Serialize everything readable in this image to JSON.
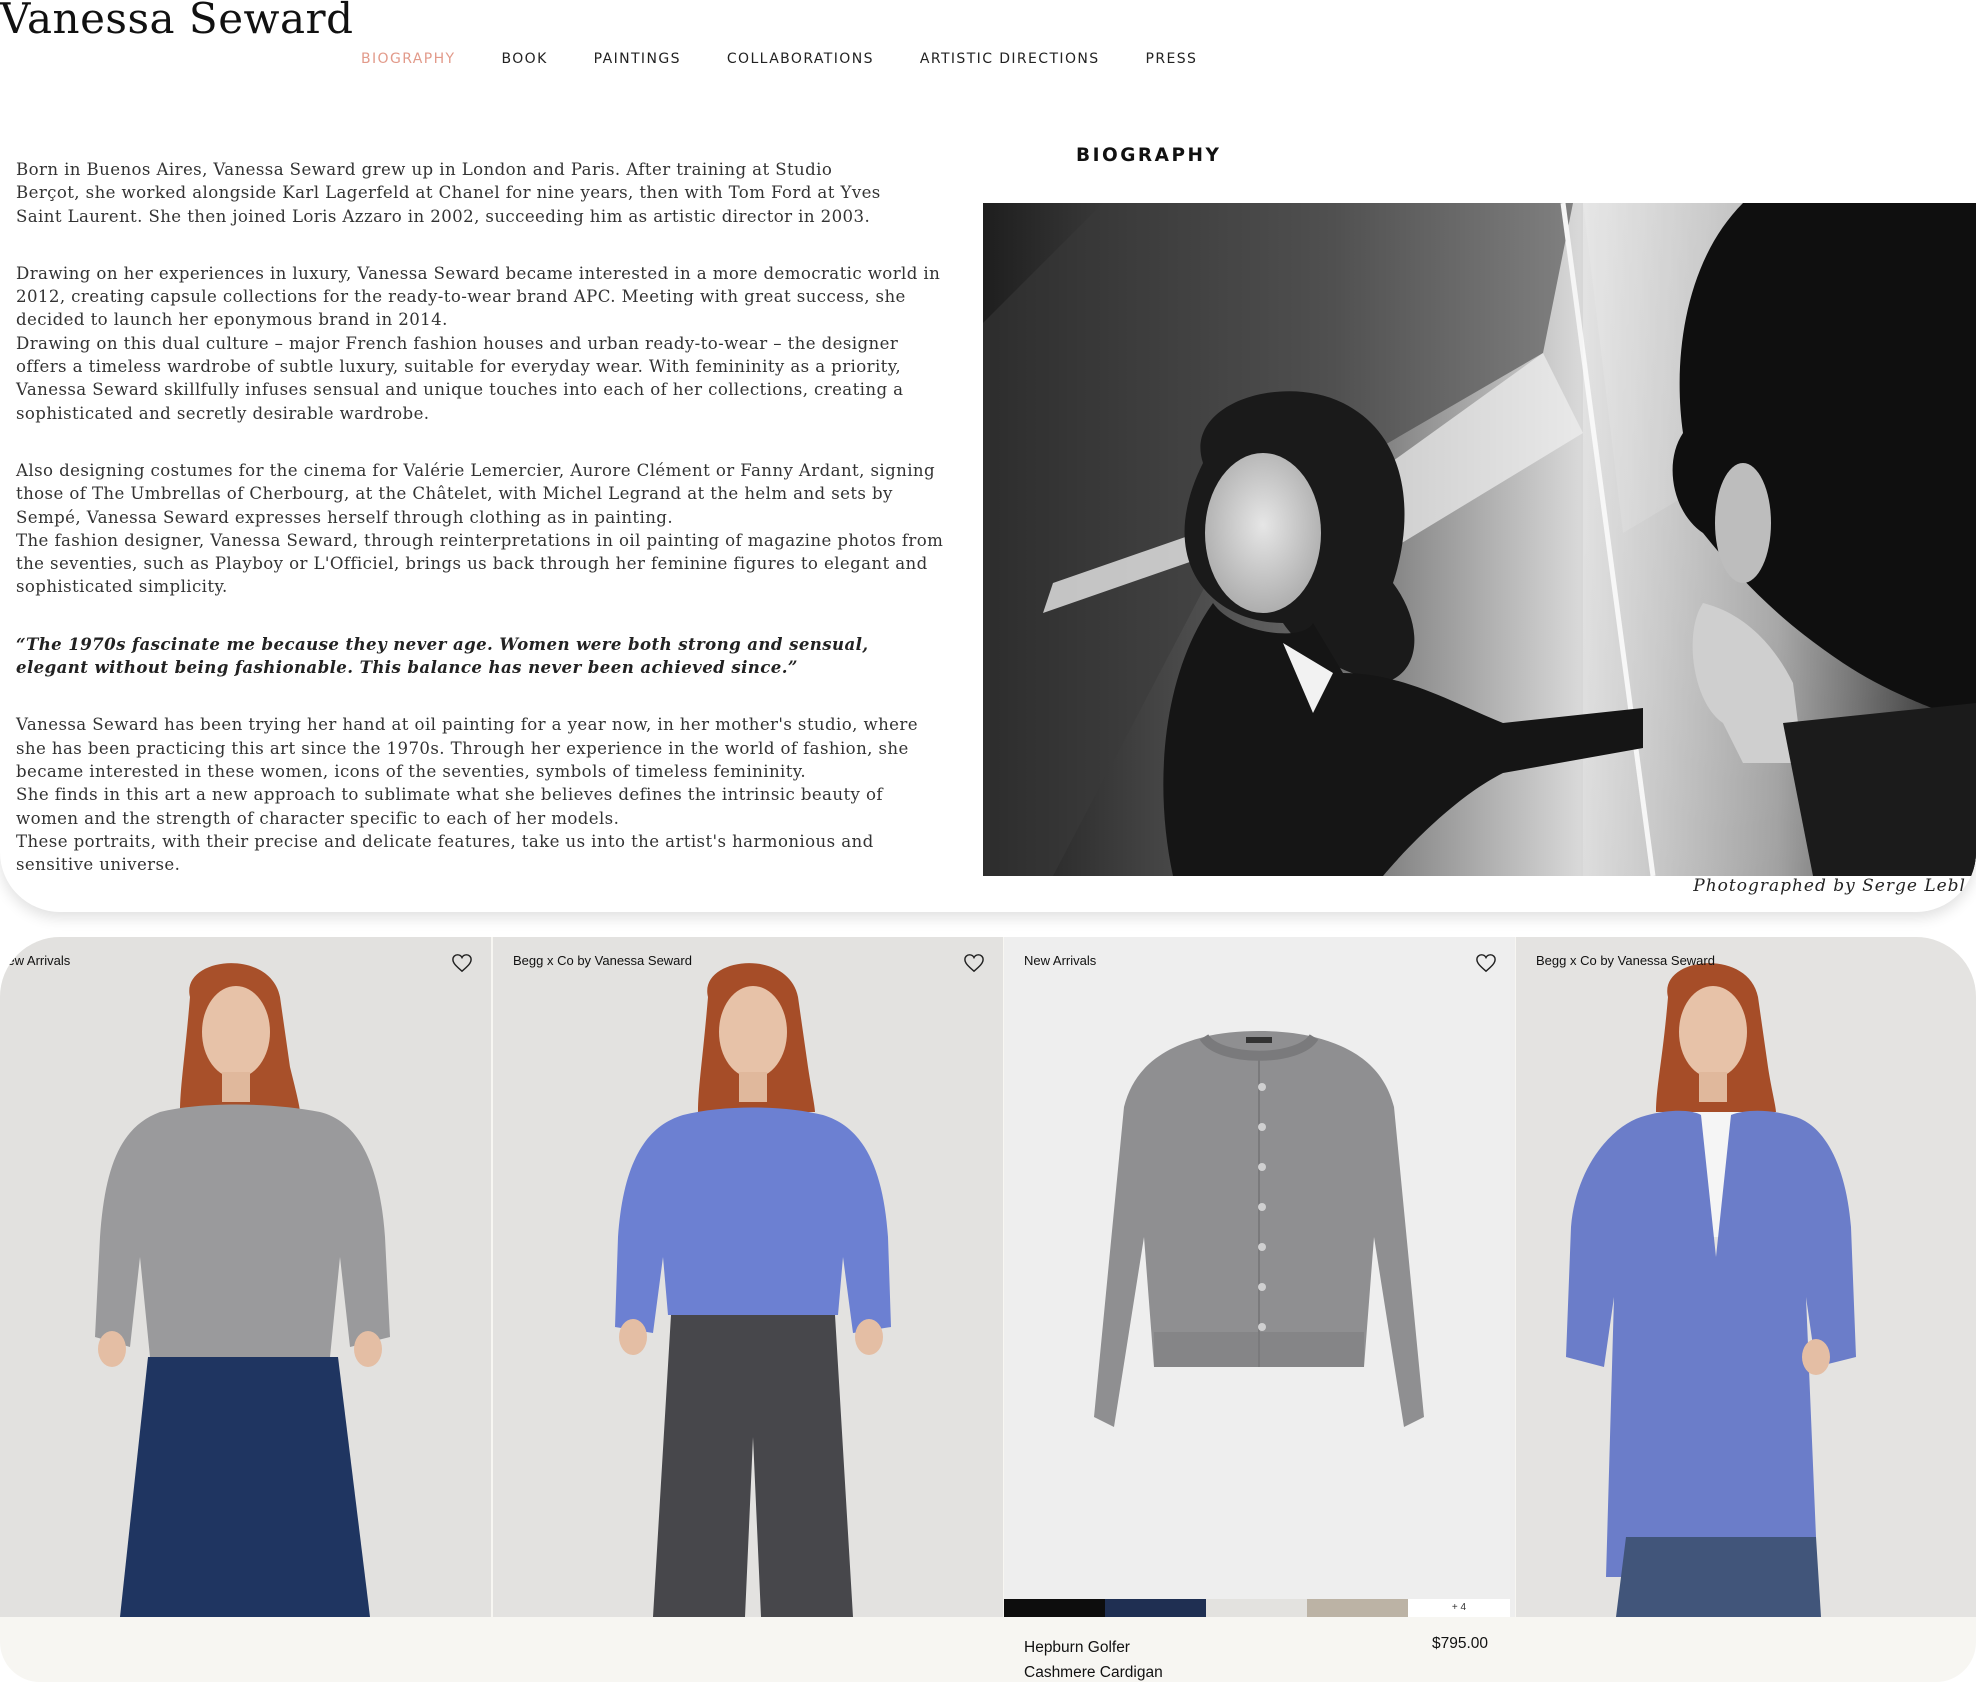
{
  "site": {
    "logo": "Vanessa Seward"
  },
  "nav": {
    "items": [
      {
        "label": "BIOGRAPHY",
        "active": true
      },
      {
        "label": "BOOK"
      },
      {
        "label": "PAINTINGS"
      },
      {
        "label": "COLLABORATIONS"
      },
      {
        "label": "ARTISTIC DIRECTIONS"
      },
      {
        "label": "PRESS"
      }
    ],
    "active_color": "#e29a8a"
  },
  "biography": {
    "heading": "BIOGRAPHY",
    "paragraphs": [
      [
        "Born in Buenos Aires, Vanessa Seward grew up in London and Paris. After training at Studio",
        "Berçot, she worked alongside Karl Lagerfeld at Chanel for nine years, then with Tom Ford at Yves",
        "Saint Laurent. She then joined Loris Azzaro in 2002, succeeding him as artistic director in 2003."
      ],
      [
        "Drawing on her experiences in luxury, Vanessa Seward became interested in a more democratic world in",
        "2012, creating capsule collections for the ready-to-wear brand APC. Meeting with great success, she",
        "decided to launch her eponymous brand in 2014.",
        "Drawing on this dual culture – major French fashion houses and urban ready-to-wear – the designer",
        "offers a timeless wardrobe of subtle luxury, suitable for everyday wear. With femininity as a priority,",
        "Vanessa Seward skillfully infuses sensual and unique touches into each of her collections, creating a",
        "sophisticated and secretly desirable wardrobe."
      ],
      [
        "Also designing costumes for the cinema for Valérie Lemercier, Aurore Clément or Fanny Ardant, signing",
        "those of The Umbrellas of Cherbourg, at the Châtelet, with Michel Legrand at the helm and sets by",
        "Sempé, Vanessa Seward expresses herself through clothing as in painting.",
        "The fashion designer, Vanessa Seward, through reinterpretations in oil painting of magazine photos from",
        "the seventies, such as Playboy or L'Officiel, brings us back through her feminine figures to elegant and",
        "sophisticated simplicity."
      ]
    ],
    "quote": [
      "“The 1970s fascinate me because they never age. Women were both strong and sensual,",
      "elegant without being fashionable. This balance has never been achieved since.”"
    ],
    "closing": [
      "Vanessa Seward has been trying her hand at oil painting for a year now, in her mother's studio, where",
      "she has been practicing this art since the 1970s. Through her experience in the world of fashion, she",
      "became interested in these women, icons of the seventies, symbols of timeless femininity.",
      "She finds in this art a new approach to sublimate what she believes defines the intrinsic beauty of",
      "women and the strength of character specific to each of her models.",
      "These portraits, with their precise and delicate features, take us into the artist's harmonious and",
      "sensitive universe."
    ],
    "photo_credit": "Photographed by Serge Lebl"
  },
  "products": [
    {
      "tag": "New Arrivals",
      "garment": "grey sweater, blue denim skirt"
    },
    {
      "tag": "Begg x Co by Vanessa Seward",
      "garment": "blue sweater, grey trousers"
    },
    {
      "tag": "New Arrivals",
      "garment": "grey cardigan",
      "name_lines": [
        "Hepburn Golfer",
        "Cashmere Cardigan"
      ],
      "price": "$795.00",
      "swatches": [
        "#0d0d0d",
        "#1f2f52",
        "#e3e2df",
        "#bcb3a5"
      ],
      "more_colors": "+ 4"
    },
    {
      "tag": "Begg x Co by Vanessa Seward",
      "garment": "blue long cardigan, jeans"
    }
  ]
}
